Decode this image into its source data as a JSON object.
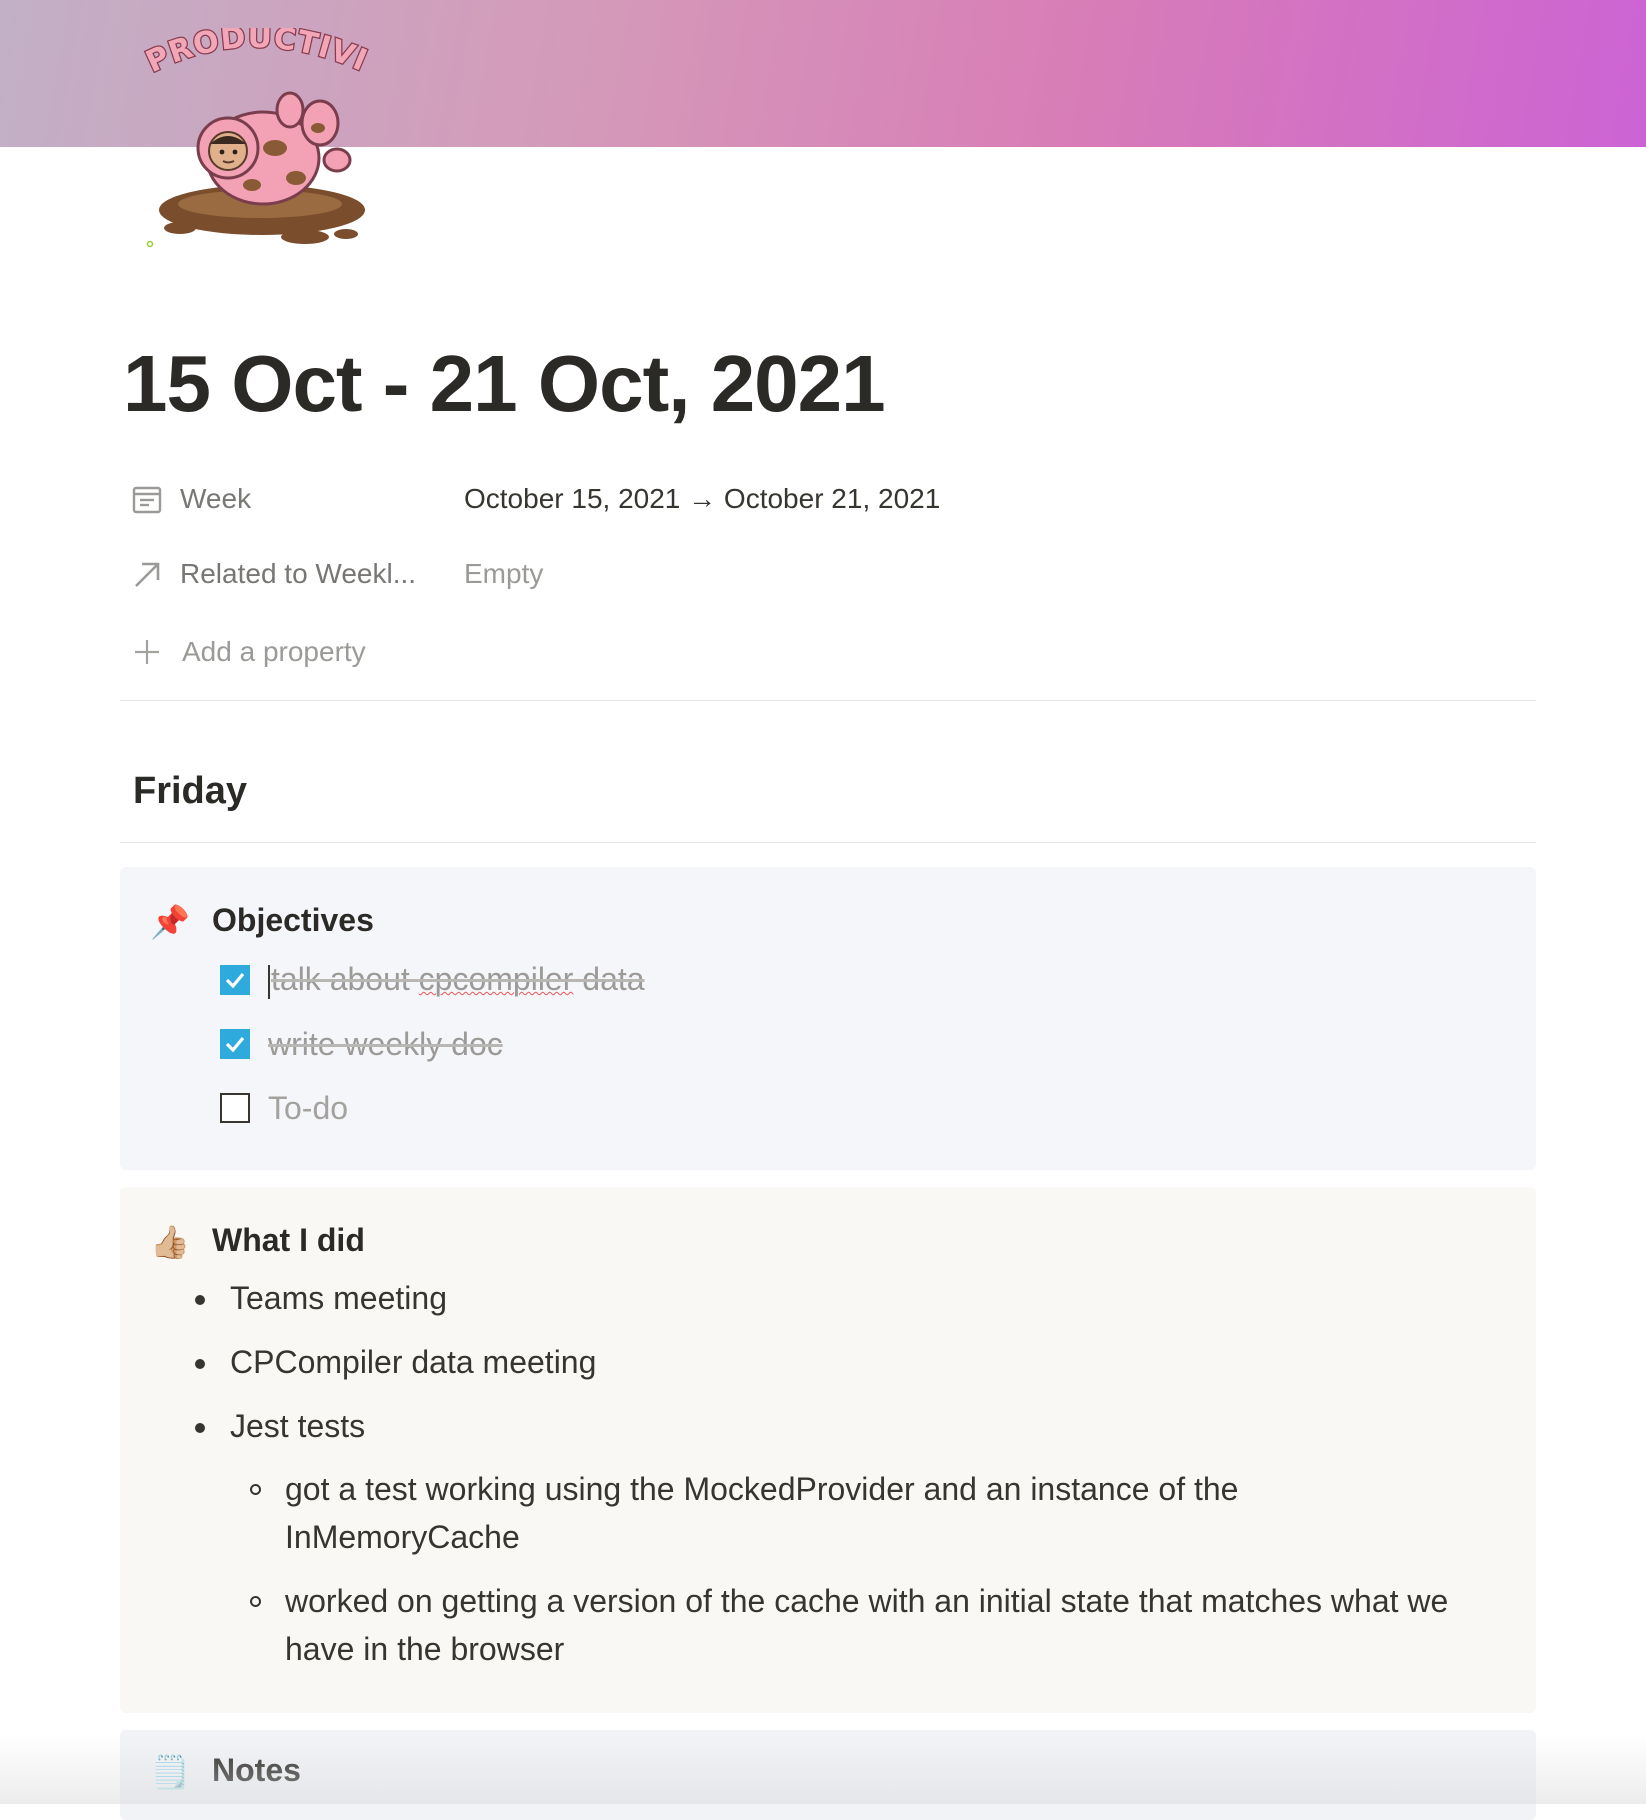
{
  "cover": {
    "gradient_colors": [
      "#c2b0c6",
      "#d49ab9",
      "#d87db7",
      "#cc63d4"
    ]
  },
  "page_icon": {
    "lettering": "PRODUCTIVITY",
    "icon": "pig-in-mud-sticker"
  },
  "page": {
    "title": "15 Oct - 21 Oct, 2021"
  },
  "properties": [
    {
      "icon": "calendar-icon",
      "name": "Week",
      "value": "October 15, 2021 → October 21, 2021"
    },
    {
      "icon": "relation-arrow-icon",
      "name": "Related to Weekl...",
      "value": "Empty"
    }
  ],
  "add_property": {
    "label": "Add a property",
    "icon": "plus-icon"
  },
  "day": {
    "heading": "Friday"
  },
  "objectives": {
    "emoji": "📌",
    "title": "Objectives",
    "todos": [
      {
        "prefix": "talk about ",
        "flagged": "cpcompiler",
        "suffix": " data",
        "checked": true
      },
      {
        "text": "write weekly doc",
        "checked": true
      },
      {
        "placeholder": "To-do",
        "checked": false
      }
    ]
  },
  "what_i_did": {
    "emoji": "👍🏼",
    "title": "What I did",
    "items": [
      "Teams meeting",
      "CPCompiler data meeting",
      "Jest tests"
    ],
    "sub_items": [
      "got a test working using the MockedProvider and an instance of the InMemoryCache",
      "worked on getting a version of the cache with an initial state that matches what we have in the browser"
    ]
  },
  "notes": {
    "emoji": "🗒️",
    "title": "Notes"
  },
  "colors": {
    "text": "#37352f",
    "muted": "#787774",
    "placeholder": "#9b9a97",
    "checkbox_checked": "#2eaadc",
    "callout_blue": "#f5f6fa",
    "callout_beige": "#f9f8f5"
  }
}
